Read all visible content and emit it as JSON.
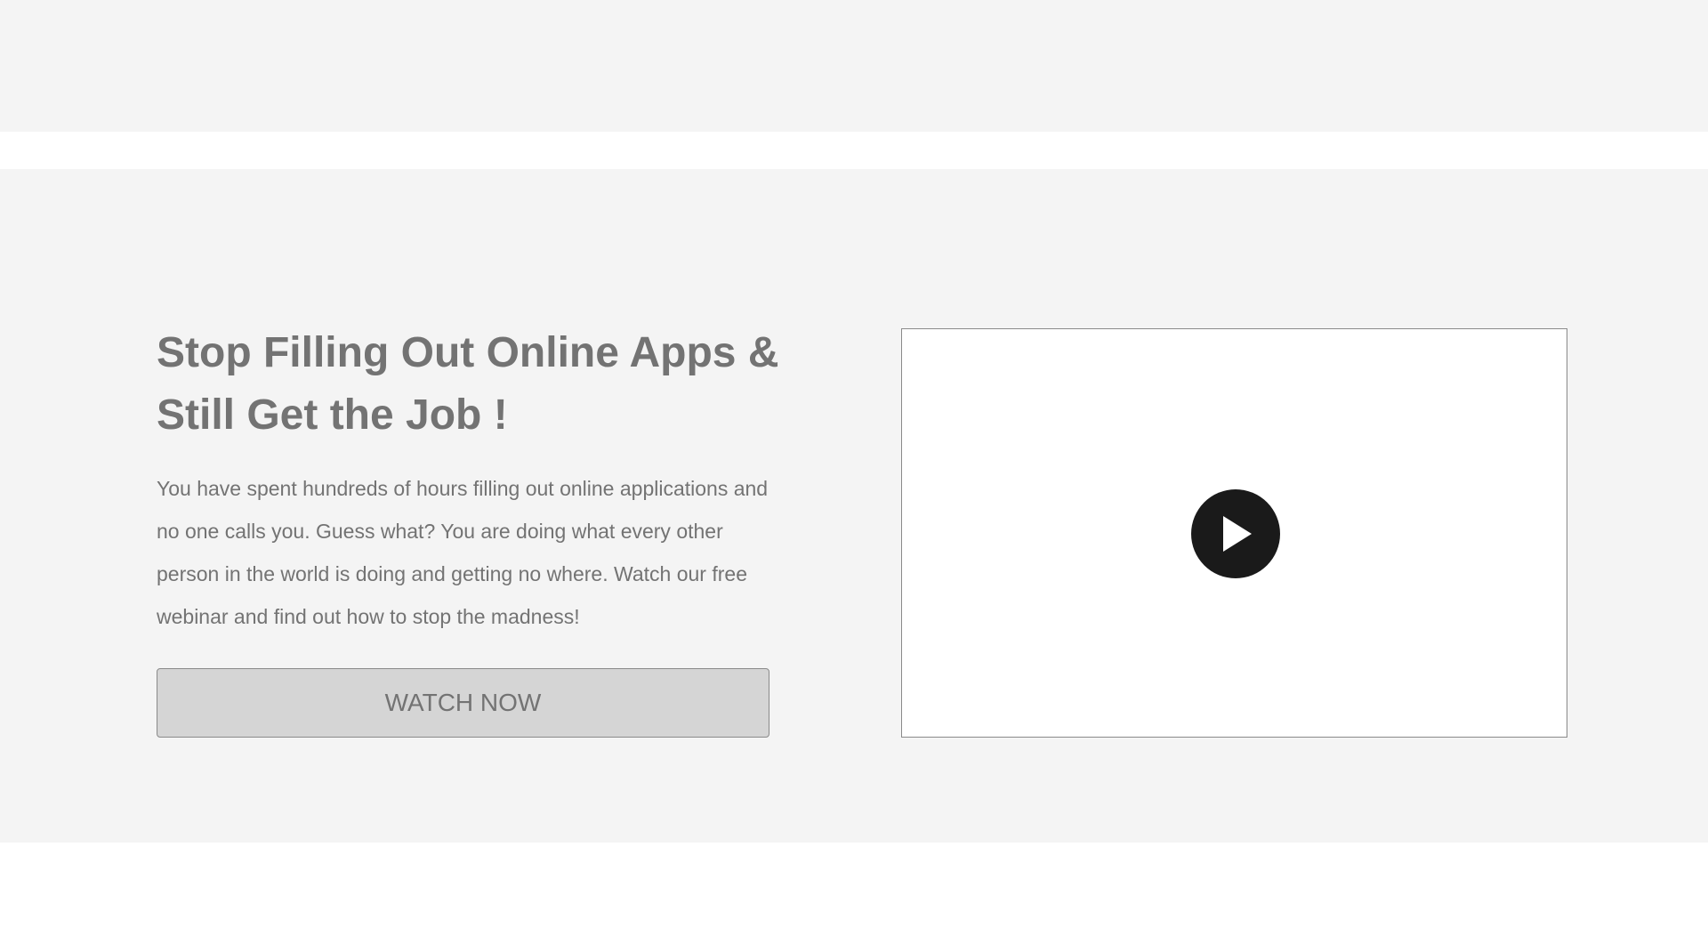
{
  "hero": {
    "headline": "Stop Filling Out Online Apps & Still Get the Job !",
    "description": "You have spent hundreds of hours filling out online applications and no one calls you. Guess what? You are doing what every other person in the world is doing and getting no where. Watch our free webinar and find out how to stop the madness!",
    "cta_label": "WATCH NOW"
  },
  "video": {
    "play_icon": "play-icon"
  },
  "colors": {
    "section_bg": "#f4f4f4",
    "text": "#737373",
    "button_bg": "#d5d5d5",
    "play_bg": "#1a1a1a"
  }
}
